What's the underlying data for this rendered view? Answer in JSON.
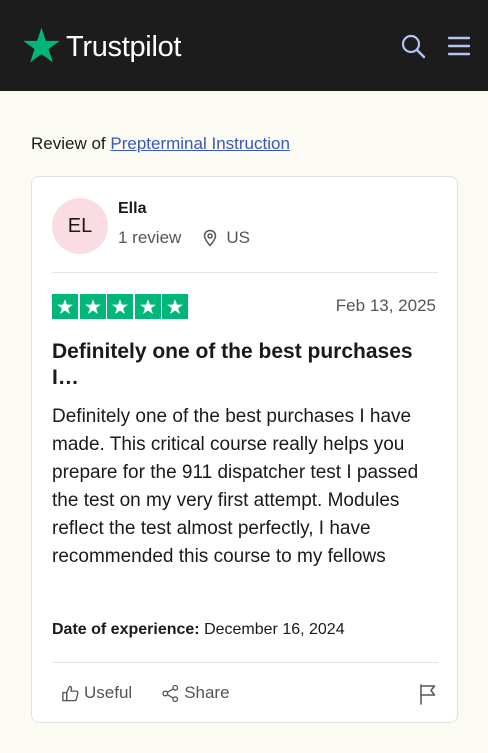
{
  "header": {
    "brand_name": "Trustpilot",
    "brand_star_color": "#00b67a",
    "search_icon": "search-icon",
    "menu_icon": "hamburger-menu-icon"
  },
  "review_of": {
    "prefix": "Review of",
    "company_name": "Prepterminal Instruction"
  },
  "reviewer": {
    "initials": "EL",
    "name": "Ella",
    "review_count": "1 review",
    "country": "US",
    "avatar_color": "#fadce3"
  },
  "review": {
    "rating": 5,
    "rating_max": 5,
    "star_color": "#00b67a",
    "date": "Feb 13, 2025",
    "title": "Definitely one of the best purchases I…",
    "body": "Definitely one of the best purchases I have made. This critical course really helps you prepare for the 911 dispatcher test I passed the test on my very first attempt. Modules reflect the test almost perfectly, I have recommended this course to my fellows",
    "experience_label": "Date of experience:",
    "experience_date": "December 16, 2024"
  },
  "actions": {
    "useful_label": "Useful",
    "share_label": "Share",
    "report_icon": "flag-icon"
  }
}
